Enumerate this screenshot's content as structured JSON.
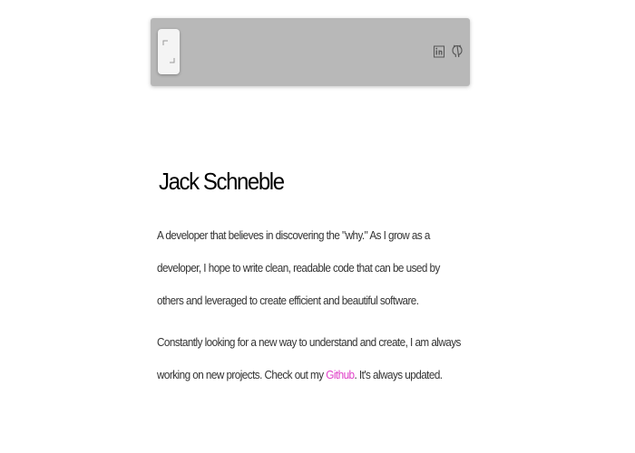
{
  "navbar": {
    "logo_icon": "bracket-logo-icon",
    "social": [
      {
        "name": "linkedin-icon",
        "label": "in"
      },
      {
        "name": "github-icon"
      }
    ]
  },
  "intro": {
    "name": "Jack Schneble",
    "para1": "A developer that believes in discovering the \"why.\" As I grow as a developer, I hope to write clean, readable code that can be used by others and leveraged to create efficient and beautiful software.",
    "para2_before": "Constantly looking for a new way to understand and create, I am always working on new projects. Check out my ",
    "para2_link": "Github",
    "para2_after": ". It's always updated.",
    "link_color": "#e040c8"
  }
}
